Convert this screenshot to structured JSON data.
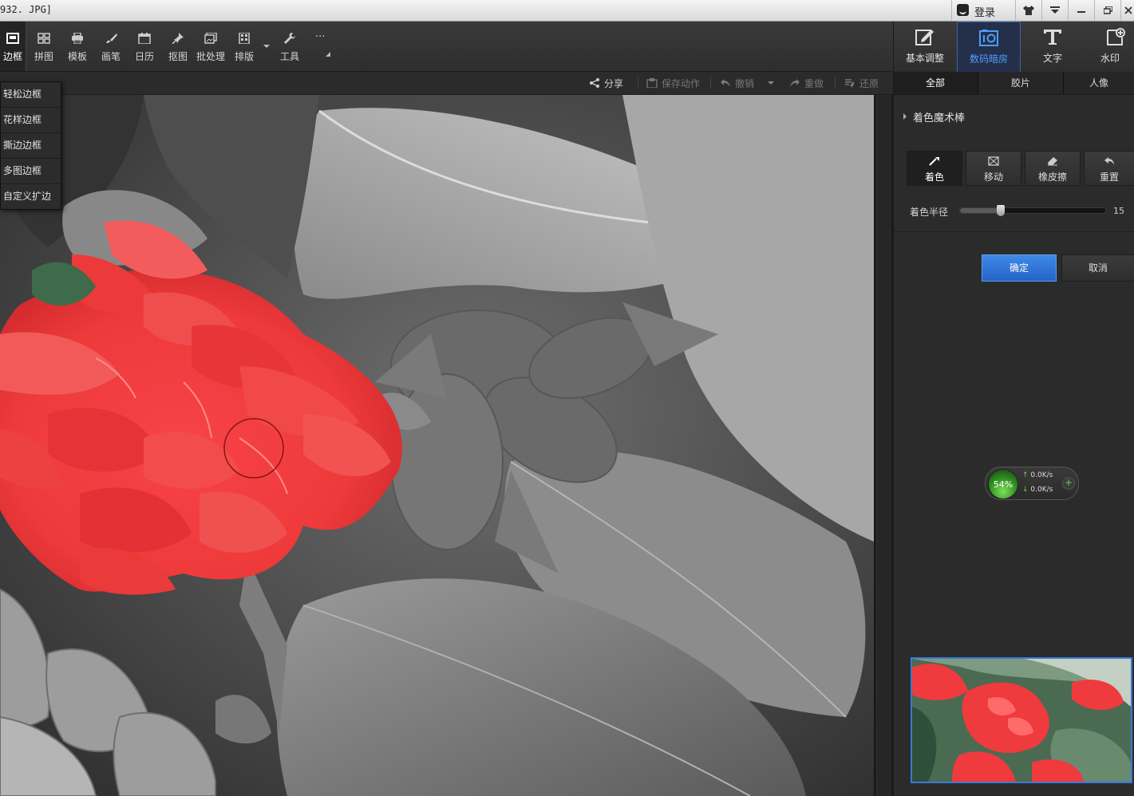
{
  "window": {
    "title": "932. JPG]",
    "login": "登录",
    "controls": [
      "shirt-icon",
      "menu-down-icon",
      "minimize-icon",
      "restore-icon",
      "close-icon"
    ]
  },
  "toolbar": {
    "items": [
      {
        "label": "边框",
        "icon": "frame-icon",
        "active": true
      },
      {
        "label": "拼图",
        "icon": "grid-icon"
      },
      {
        "label": "模板",
        "icon": "printer-icon"
      },
      {
        "label": "画笔",
        "icon": "brush-icon"
      },
      {
        "label": "日历",
        "icon": "calendar-icon"
      },
      {
        "label": "抠图",
        "icon": "pin-icon"
      },
      {
        "label": "批处理",
        "icon": "batch-icon"
      },
      {
        "label": "排版",
        "icon": "layout-icon"
      },
      {
        "label": "工具",
        "icon": "wrench-icon"
      }
    ],
    "more": "···"
  },
  "right_tabs": [
    {
      "label": "基本调整",
      "icon": "edit-square-icon"
    },
    {
      "label": "数码暗房",
      "icon": "darkroom-icon",
      "active": true
    },
    {
      "label": "文字",
      "icon": "text-T-icon"
    },
    {
      "label": "水印",
      "icon": "watermark-icon"
    }
  ],
  "actions": {
    "share": "分享",
    "save_action": "保存动作",
    "undo": "撤销",
    "redo": "重做",
    "restore": "还原"
  },
  "right_subtabs": [
    "全部",
    "胶片",
    "人像"
  ],
  "dropdown": [
    "轻松边框",
    "花样边框",
    "撕边边框",
    "多图边框",
    "自定义扩边"
  ],
  "panel": {
    "section_title": "着色魔术棒",
    "modes": [
      {
        "label": "着色",
        "icon": "wand-icon",
        "active": true
      },
      {
        "label": "移动",
        "icon": "move-icon"
      },
      {
        "label": "橡皮擦",
        "icon": "eraser-icon"
      },
      {
        "label": "重置",
        "icon": "reset-icon"
      }
    ],
    "radius_label": "着色半径",
    "radius_value": "15",
    "radius_fraction": 0.15,
    "ok": "确定",
    "cancel": "取消"
  },
  "net_widget": {
    "percent": "54%",
    "up": "0.0K/s",
    "down": "0.0K/s"
  },
  "colors": {
    "accent": "#3f8ae8",
    "active_tab_text": "#4f9cff",
    "flower_red": "#f03a3a"
  }
}
